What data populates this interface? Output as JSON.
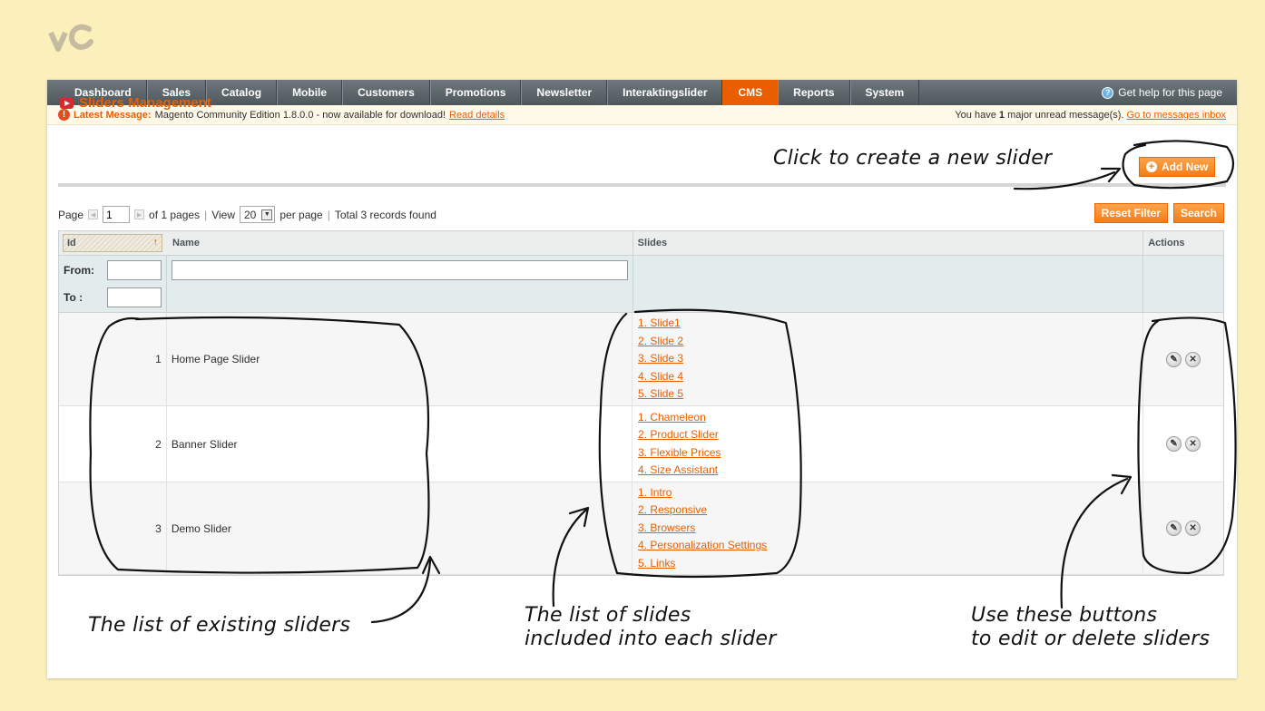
{
  "nav": {
    "items": [
      "Dashboard",
      "Sales",
      "Catalog",
      "Mobile",
      "Customers",
      "Promotions",
      "Newsletter",
      "Interaktingslider",
      "CMS",
      "Reports",
      "System"
    ],
    "active": "CMS",
    "help": "Get help for this page"
  },
  "message": {
    "title": "Latest Message:",
    "text": "Magento Community Edition 1.8.0.0 - now available for download!",
    "link": "Read details",
    "right_prefix": "You have",
    "right_count": "1",
    "right_suffix": "major unread message(s).",
    "right_link": "Go to messages inbox"
  },
  "header": {
    "title": "Sliders Management",
    "add_button": "Add New"
  },
  "pager": {
    "page_label": "Page",
    "page_value": "1",
    "of_pages": "of 1 pages",
    "view_label": "View",
    "view_value": "20",
    "per_page": "per page",
    "total": "Total 3 records found",
    "reset_filter": "Reset Filter",
    "search": "Search"
  },
  "grid": {
    "columns": {
      "id": "Id",
      "name": "Name",
      "slides": "Slides",
      "actions": "Actions"
    },
    "filter": {
      "from": "From:",
      "to": "To :"
    },
    "rows": [
      {
        "id": "1",
        "name": "Home Page Slider",
        "slides": [
          "1. Slide1",
          "2. Slide 2",
          "3. Slide 3",
          "4. Slide 4",
          "5. Slide 5"
        ]
      },
      {
        "id": "2",
        "name": "Banner Slider",
        "slides": [
          "1. Chameleon",
          "2. Product Slider",
          "3. Flexible Prices",
          "4. Size Assistant"
        ]
      },
      {
        "id": "3",
        "name": "Demo Slider",
        "slides": [
          "1. Intro",
          "2. Responsive",
          "3. Browsers",
          "4. Personalization Settings",
          "5. Links"
        ]
      }
    ]
  },
  "annotations": {
    "create": "Click to create a new slider",
    "existing": "The list of existing sliders",
    "slides_line1": "The list of slides",
    "slides_line2": "included into each slider",
    "buttons_line1": "Use these buttons",
    "buttons_line2": "to edit or delete sliders"
  },
  "colors": {
    "accent": "#eb5e00",
    "background": "#fbf0bb",
    "nav": "#5a6367"
  },
  "icons": {
    "help": "help-icon",
    "warning": "warning-icon",
    "title": "slider-icon",
    "add": "plus-icon",
    "edit": "edit-icon",
    "delete": "delete-icon"
  }
}
